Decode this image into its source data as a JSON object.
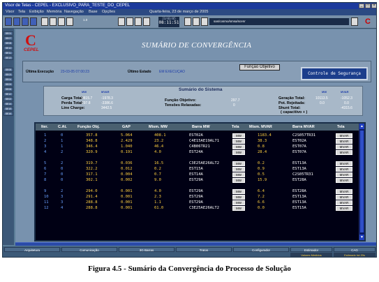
{
  "window": {
    "title": "Visor de Telas - CEPEL - EXCLUSIVO_PARA_TESTE_DO_CEPEL",
    "date": "Quarta-feira, 23 de março de 2005"
  },
  "menu": [
    "Visor",
    "Tela",
    "Exibição",
    "Memória",
    "Navegação",
    "Base",
    "Opções"
  ],
  "toolbar": {
    "zoom": "1.0",
    "clock_date": "23/03/05",
    "clock_time": "08:11:51",
    "combo": "sas/cosmo/smsa/scenr"
  },
  "left_tabs": [
    "SE01",
    "SE07",
    "SE08",
    "SE10",
    "SE11",
    "SE13",
    "SE05",
    "SE03",
    "SE04",
    "SE09",
    "SE06",
    "SE12",
    "SE02",
    "SE14",
    "SE15",
    "SE16"
  ],
  "header": {
    "logo_text": "CEPEL",
    "title": "SUMÁRIO DE CONVERGÊNCIA"
  },
  "infobar": {
    "ultima_execucao_label": "Última Execução",
    "ultima_execucao_value": "23-03-05 07:00:23",
    "ultimo_estado_label": "Último Estado",
    "ultimo_estado_value": "EM EXECUÇAO",
    "funcao_objetivo_button": "Função Objetivo",
    "controle_seguranca_button": "Controle de Segurança"
  },
  "system_summary": {
    "title": "Sumário do Sistema",
    "left": {
      "col_headers": [
        "MW",
        "MVAR"
      ],
      "rows": [
        {
          "label": "Carga Total:",
          "mw": "9815.7",
          "mvar": "-1978.3"
        },
        {
          "label": "Perda Total:",
          "mw": "297.8",
          "mvar": "-3386.6"
        },
        {
          "label": "Line Charge:",
          "mw": "",
          "mvar": "3442.5"
        }
      ]
    },
    "middle": [
      {
        "label": "Função Objetivo:",
        "value": "297.7"
      },
      {
        "label": "Tensões Relaxadas:",
        "value": "0"
      }
    ],
    "right": {
      "col_headers": [
        "MW",
        "MVAR"
      ],
      "rows": [
        {
          "label": "Geração Total:",
          "mw": "10113.5",
          "mvar": "-1052.3"
        },
        {
          "label": "Pot. Rejeitada:",
          "mw": "0.0",
          "mvar": "0.0"
        },
        {
          "label": "Shunt Total:",
          "mw": "",
          "mvar": "-4315.6"
        },
        {
          "label": "( capacitivo + )",
          "mw": "",
          "mvar": ""
        }
      ]
    }
  },
  "table": {
    "headers": [
      "Iter.",
      "C.At.",
      "Função Obj.",
      "GAP",
      "Mism. MW",
      "Barra MW",
      "Tela",
      "Mism. MVAR",
      "Barra MVAR",
      "Tela"
    ],
    "groups": [
      [
        [
          "1",
          "0",
          "357.8",
          "5.064",
          "408.1",
          "EST02A",
          "MW",
          "1183.4",
          "C2S057TR31",
          "MVAR"
        ],
        [
          "2",
          "1",
          "348.8",
          "2.429",
          "23.2",
          "C4E15AE19AL71",
          "MW",
          "38.3",
          "EST02A",
          "MVAR"
        ],
        [
          "3",
          "1",
          "346.4",
          "1.040",
          "46.4",
          "C4B06TR21",
          "MW",
          "0.8",
          "EST07A",
          "MVAR"
        ],
        [
          "4",
          "2",
          "320.9",
          "0.191",
          "4.0",
          "EST24A",
          "MW",
          "28.4",
          "EST07A",
          "MVAR"
        ]
      ],
      [
        [
          "5",
          "2",
          "319.7",
          "0.036",
          "16.5",
          "C3E25AE26ALT2",
          "MW",
          "0.2",
          "EST13A",
          "MVAR"
        ],
        [
          "6",
          "0",
          "322.2",
          "0.012",
          "0.2",
          "EST15A",
          "MW",
          "0.9",
          "EST13A",
          "MVAR"
        ],
        [
          "7",
          "0",
          "317.1",
          "0.004",
          "0.7",
          "EST14A",
          "MW",
          "0.5",
          "C2S05TR31",
          "MVAR"
        ],
        [
          "8",
          "0",
          "302.1",
          "0.002",
          "9.0",
          "EST29A",
          "MW",
          "15.9",
          "EST28A",
          "MVAR"
        ]
      ],
      [
        [
          "9",
          "2",
          "294.0",
          "0.001",
          "4.0",
          "EST29A",
          "MW",
          "6.4",
          "EST28A",
          "MVAR"
        ],
        [
          "10",
          "3",
          "291.4",
          "0.001",
          "2.3",
          "EST29A",
          "MW",
          "7.2",
          "EST13A",
          "MVAR"
        ],
        [
          "11",
          "3",
          "288.8",
          "0.001",
          "1.1",
          "EST29A",
          "MW",
          "6.6",
          "EST13A",
          "MVAR"
        ],
        [
          "12",
          "4",
          "288.8",
          "0.001",
          "61.0",
          "C3E25AE26ALT2",
          "MW",
          "0.0",
          "EST15A",
          "MVAR"
        ]
      ]
    ]
  },
  "statusbar": {
    "items": [
      "Arquitetura",
      "Comunicação",
      "3G Barras",
      "Tratos",
      "Configurador",
      "Estimador",
      "CAG"
    ],
    "sub_items": [
      "Valores Medidos",
      "Estimado há 20s"
    ]
  },
  "caption": "Figura 4.5 - Sumário da Convergência do Processo de Solução",
  "colors": {
    "value_blue": "#6aa0ff",
    "value_yellow": "#ffd040",
    "brand_red": "#d01010"
  }
}
